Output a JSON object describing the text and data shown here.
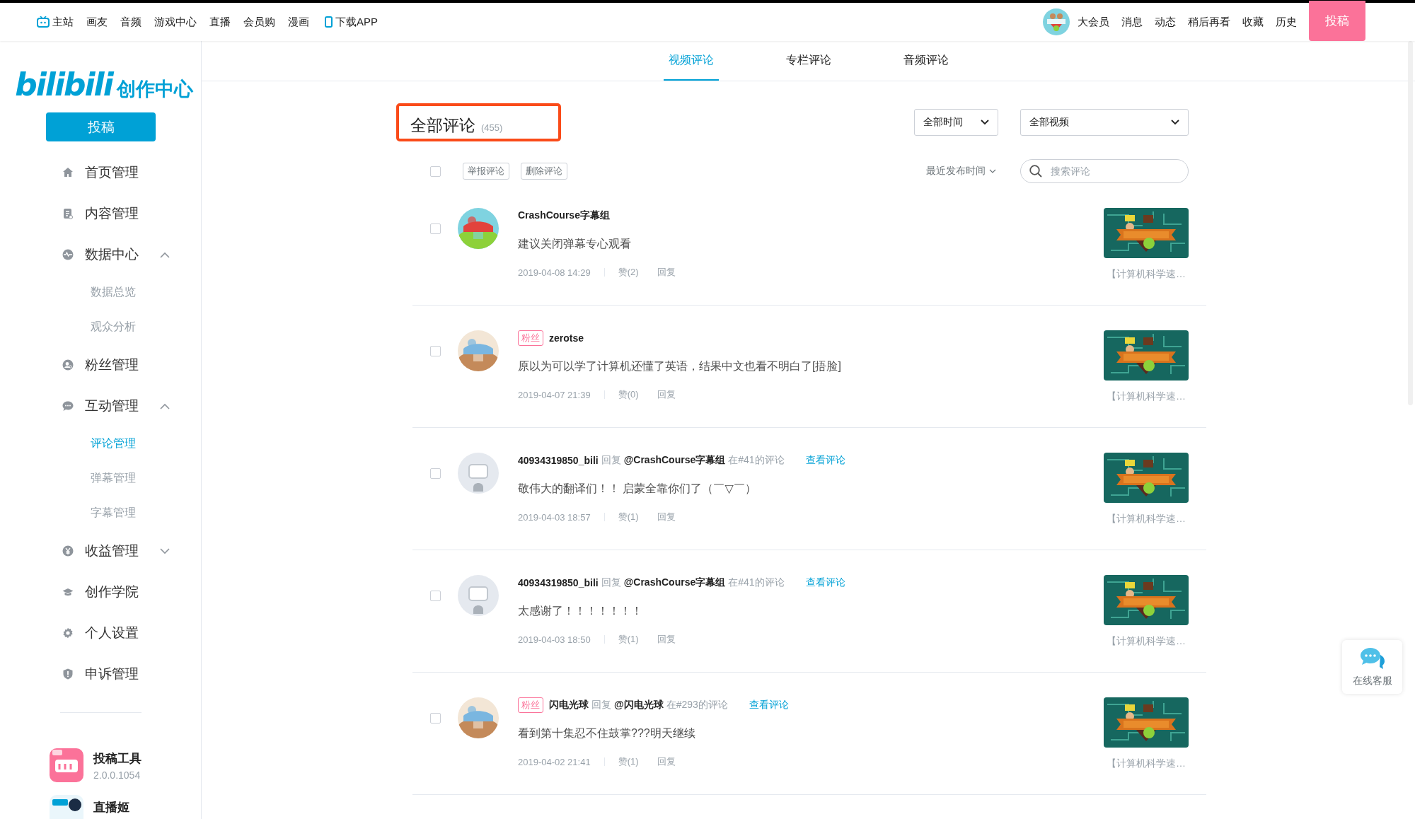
{
  "top_nav": {
    "left_items": [
      {
        "label": "主站",
        "kind": "home"
      },
      {
        "label": "画友",
        "kind": "plain"
      },
      {
        "label": "音频",
        "kind": "plain"
      },
      {
        "label": "游戏中心",
        "kind": "plain"
      },
      {
        "label": "直播",
        "kind": "plain"
      },
      {
        "label": "会员购",
        "kind": "plain"
      },
      {
        "label": "漫画",
        "kind": "plain"
      },
      {
        "label": "下载APP",
        "kind": "app"
      }
    ],
    "right_items": [
      "大会员",
      "消息",
      "动态",
      "稍后再看",
      "收藏",
      "历史"
    ],
    "upload_button": "投稿"
  },
  "sidebar": {
    "logo": "bilibili",
    "logo_caption": "创作中心",
    "upload_button": "投稿",
    "items": [
      {
        "label": "首页管理",
        "kind": "link",
        "selected": false
      },
      {
        "label": "内容管理",
        "kind": "link",
        "selected": false
      },
      {
        "label": "数据中心",
        "kind": "group",
        "selected": false,
        "expanded": true,
        "children": [
          {
            "label": "数据总览",
            "selected": false
          },
          {
            "label": "观众分析",
            "selected": false
          }
        ]
      },
      {
        "label": "粉丝管理",
        "kind": "link",
        "selected": false
      },
      {
        "label": "互动管理",
        "kind": "group",
        "selected": false,
        "expanded": true,
        "children": [
          {
            "label": "评论管理",
            "selected": true
          },
          {
            "label": "弹幕管理",
            "selected": false
          },
          {
            "label": "字幕管理",
            "selected": false
          }
        ]
      },
      {
        "label": "收益管理",
        "kind": "group",
        "selected": false,
        "expanded": false
      },
      {
        "label": "创作学院",
        "kind": "link",
        "selected": false
      },
      {
        "label": "个人设置",
        "kind": "link",
        "selected": false
      },
      {
        "label": "申诉管理",
        "kind": "link",
        "selected": false
      }
    ],
    "tools": [
      {
        "name": "投稿工具",
        "version": "2.0.0.1054"
      },
      {
        "name": "直播姬"
      }
    ]
  },
  "tabs": [
    {
      "label": "视频评论",
      "selected": true
    },
    {
      "label": "专栏评论",
      "selected": false
    },
    {
      "label": "音频评论",
      "selected": false
    }
  ],
  "panel": {
    "title": "全部评论",
    "count": "(455)",
    "filters": [
      "全部时间",
      "全部视频"
    ],
    "select_all": {
      "checked": false
    },
    "actions": [
      "举报评论",
      "删除评论"
    ],
    "sort": "最近发布时间",
    "search": {
      "placeholder": "搜索评论"
    }
  },
  "comments": [
    {
      "checked": false,
      "default_avatar": false,
      "user": "CrashCourse字幕组",
      "text": "建议关闭弹幕专心观看",
      "date": "2019-04-08 14:29",
      "likes": "赞(2)",
      "reply": "回复",
      "video_title": "【计算机科学速…"
    },
    {
      "checked": false,
      "default_avatar": false,
      "badge": "粉丝",
      "user": "zerotse",
      "text": "原以为可以学了计算机还懂了英语，结果中文也看不明白了[捂脸]",
      "date": "2019-04-07 21:39",
      "likes": "赞(0)",
      "reply": "回复",
      "video_title": "【计算机科学速…"
    },
    {
      "checked": false,
      "default_avatar": true,
      "user": "40934319850_bili",
      "reply_word": "回复",
      "reply_to": "@CrashCourse字幕组",
      "context": "在#41的评论",
      "view_link": "查看评论",
      "text": "敬伟大的翻译们！！ 启蒙全靠你们了（￣▽￣）",
      "date": "2019-04-03 18:57",
      "likes": "赞(1)",
      "reply": "回复",
      "video_title": "【计算机科学速…"
    },
    {
      "checked": false,
      "default_avatar": true,
      "user": "40934319850_bili",
      "reply_word": "回复",
      "reply_to": "@CrashCourse字幕组",
      "context": "在#41的评论",
      "view_link": "查看评论",
      "text": "太感谢了！！！！！！！",
      "date": "2019-04-03 18:50",
      "likes": "赞(1)",
      "reply": "回复",
      "video_title": "【计算机科学速…"
    },
    {
      "checked": false,
      "default_avatar": false,
      "badge": "粉丝",
      "user": "闪电光球",
      "reply_word": "回复",
      "reply_to": "@闪电光球",
      "context": "在#293的评论",
      "view_link": "查看评论",
      "text": "看到第十集忍不住鼓掌???明天继续",
      "date": "2019-04-02 21:41",
      "likes": "赞(1)",
      "reply": "回复",
      "video_title": "【计算机科学速…"
    }
  ],
  "chat_widget": {
    "label": "在线客服"
  }
}
